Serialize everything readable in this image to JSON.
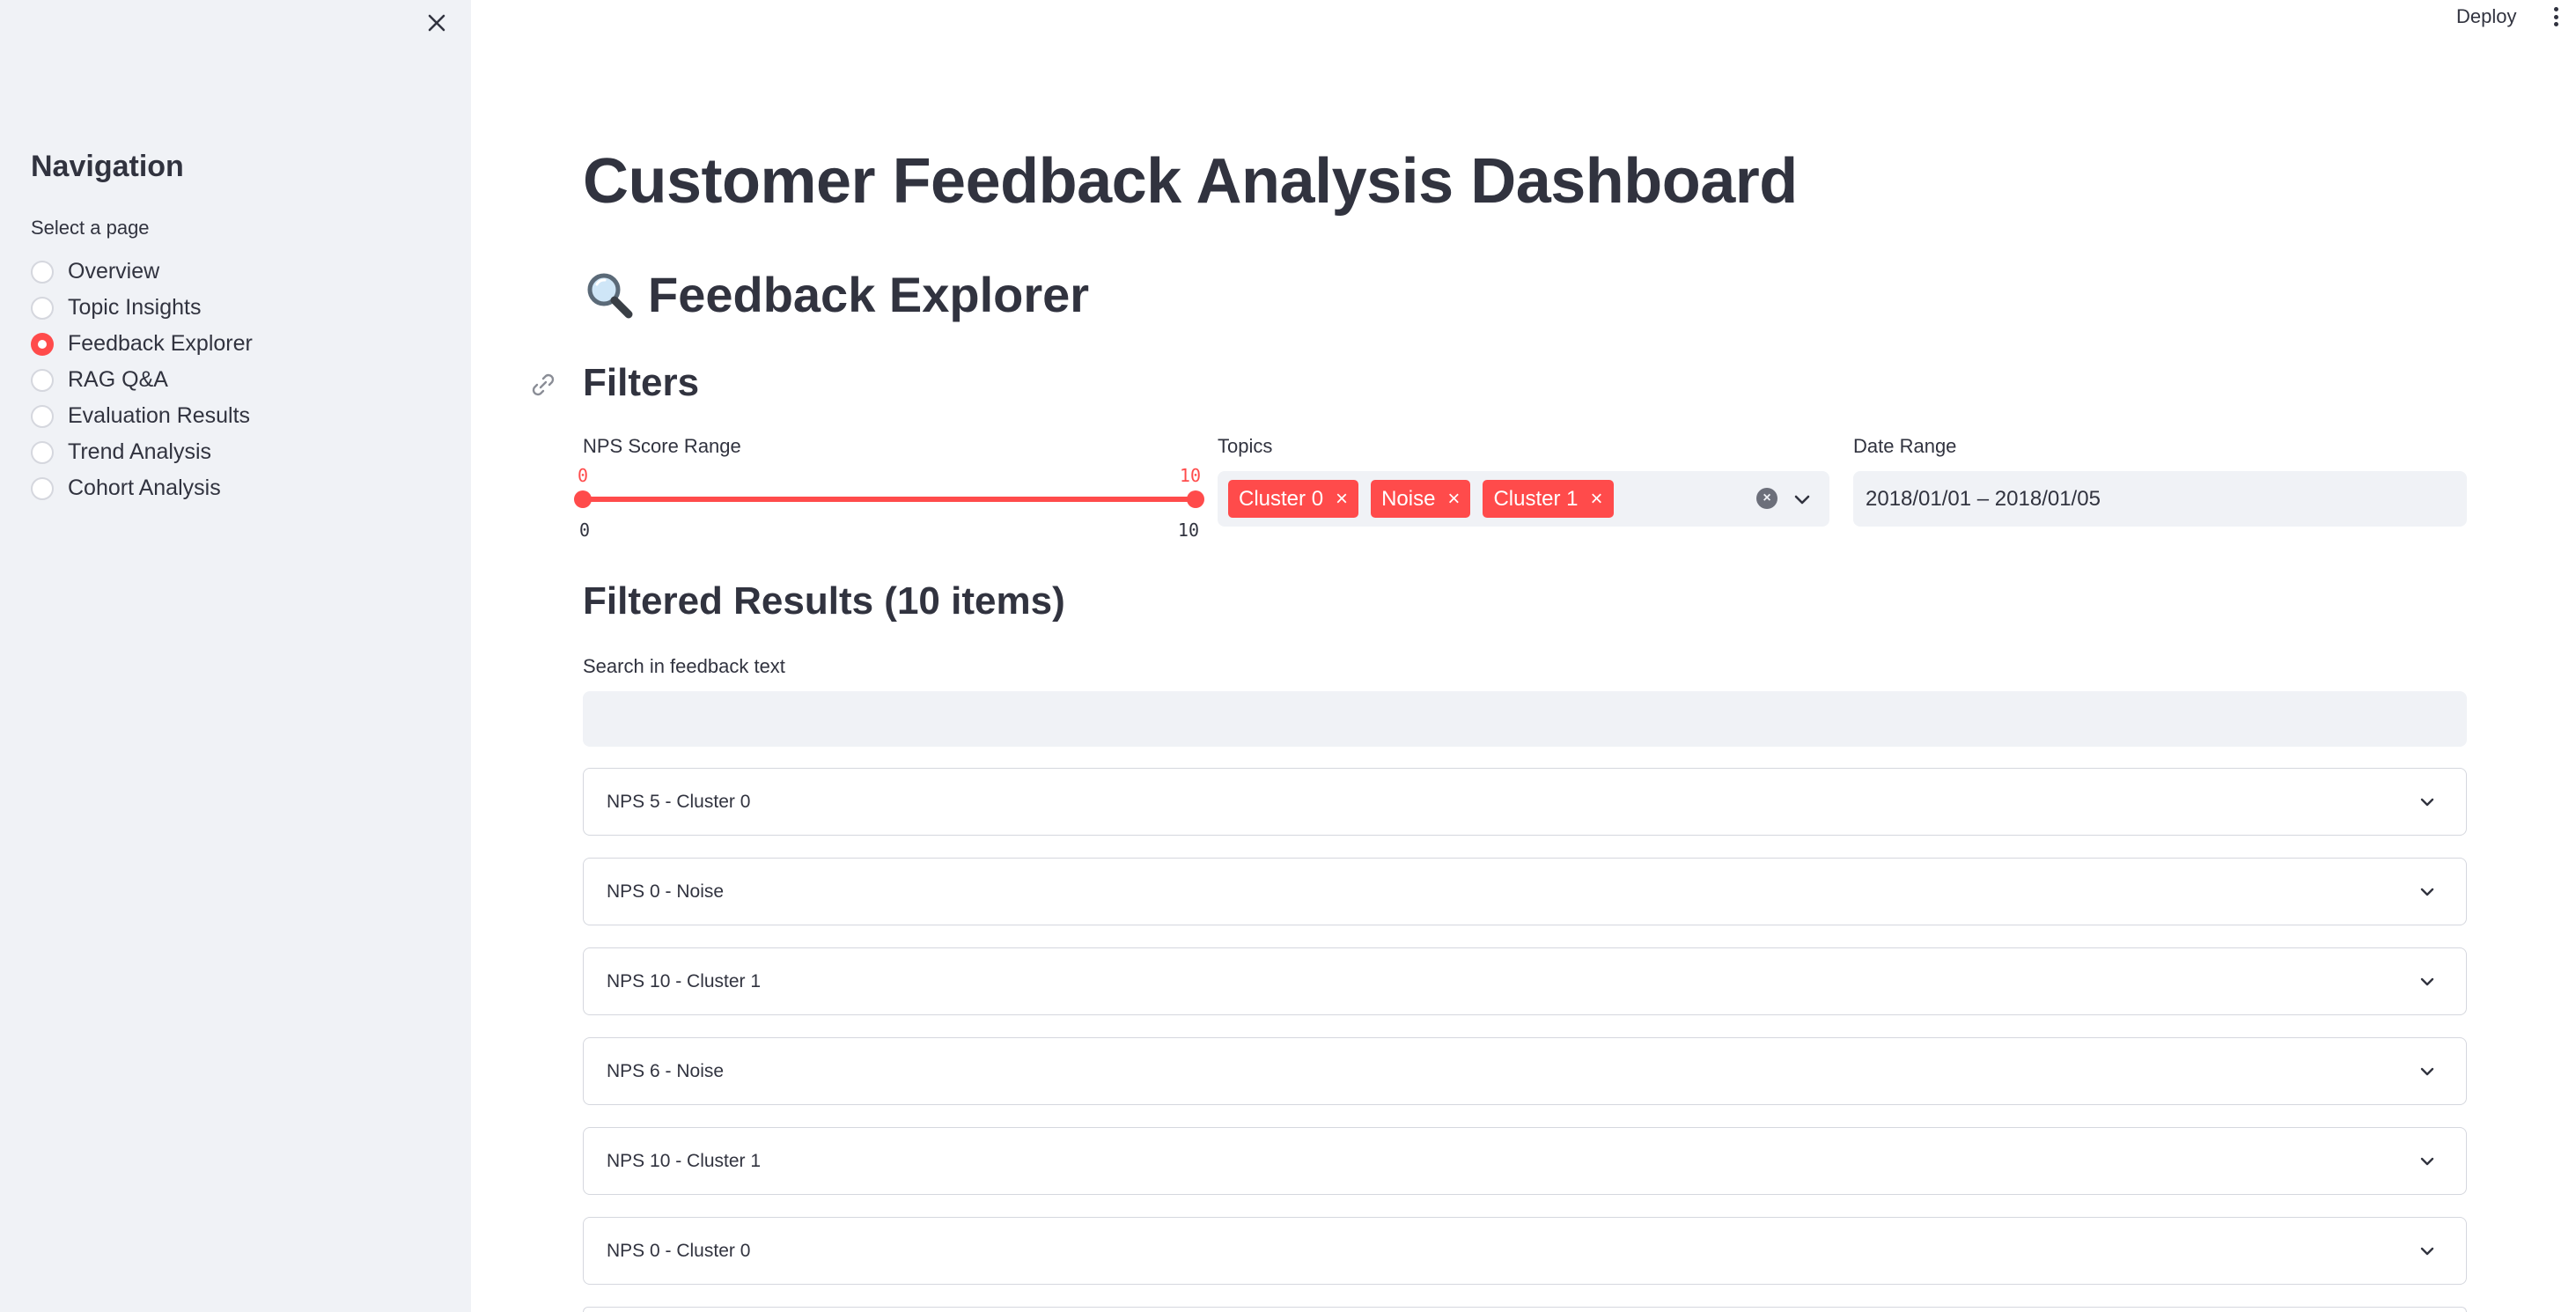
{
  "header": {
    "deploy_label": "Deploy"
  },
  "sidebar": {
    "title": "Navigation",
    "select_label": "Select a page",
    "items": [
      {
        "label": "Overview",
        "selected": false
      },
      {
        "label": "Topic Insights",
        "selected": false
      },
      {
        "label": "Feedback Explorer",
        "selected": true
      },
      {
        "label": "RAG Q&A",
        "selected": false
      },
      {
        "label": "Evaluation Results",
        "selected": false
      },
      {
        "label": "Trend Analysis",
        "selected": false
      },
      {
        "label": "Cohort Analysis",
        "selected": false
      }
    ]
  },
  "main": {
    "title": "Customer Feedback Analysis Dashboard",
    "section_title": "Feedback Explorer",
    "section_icon": "magnifying-glass-icon",
    "filters_title": "Filters",
    "nps": {
      "label": "NPS Score Range",
      "value_min": "0",
      "value_max": "10",
      "range_min": "0",
      "range_max": "10"
    },
    "topics": {
      "label": "Topics",
      "tags": [
        "Cluster 0",
        "Noise",
        "Cluster 1"
      ]
    },
    "date_range": {
      "label": "Date Range",
      "value": "2018/01/01 – 2018/01/05"
    },
    "results_title": "Filtered Results (10 items)",
    "search": {
      "label": "Search in feedback text",
      "value": "",
      "placeholder": ""
    },
    "results": [
      {
        "label": "NPS 5 - Cluster 0"
      },
      {
        "label": "NPS 0 - Noise"
      },
      {
        "label": "NPS 10 - Cluster 1"
      },
      {
        "label": "NPS 6 - Noise"
      },
      {
        "label": "NPS 10 - Cluster 1"
      },
      {
        "label": "NPS 0 - Cluster 0"
      }
    ]
  },
  "colors": {
    "accent": "#ff4b4b",
    "sidebar_bg": "#f0f2f6",
    "text": "#31333f"
  }
}
